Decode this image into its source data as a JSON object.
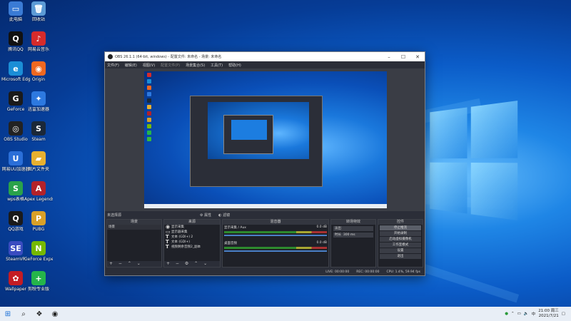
{
  "desktop": {
    "icons": [
      {
        "label": "此电脑",
        "glyph": "▭",
        "color": "#3a7bd5"
      },
      {
        "label": "回收站",
        "glyph": "🗑",
        "color": "#5c9bd6"
      },
      {
        "label": "腾讯QQ",
        "glyph": "Q",
        "color": "#111111"
      },
      {
        "label": "网易云音乐",
        "glyph": "♪",
        "color": "#d62b2b"
      },
      {
        "label": "Microsoft Edge",
        "glyph": "e",
        "color": "#1b8ed6"
      },
      {
        "label": "Origin",
        "glyph": "◉",
        "color": "#f06820"
      },
      {
        "label": "GeForce",
        "glyph": "G",
        "color": "#1a1a1a"
      },
      {
        "label": "迅雷加速器",
        "glyph": "✦",
        "color": "#2d79e0"
      },
      {
        "label": "OBS Studio",
        "glyph": "◎",
        "color": "#222222"
      },
      {
        "label": "Steam",
        "glyph": "S",
        "color": "#1b2838"
      },
      {
        "label": "网易UU加速器",
        "glyph": "U",
        "color": "#2b6fd8"
      },
      {
        "label": "图片文件夹",
        "glyph": "▰",
        "color": "#e8b030"
      },
      {
        "label": "wps表格",
        "glyph": "S",
        "color": "#2aa24a"
      },
      {
        "label": "Apex Legends",
        "glyph": "A",
        "color": "#b3222a"
      },
      {
        "label": "QQ游戏",
        "glyph": "Q",
        "color": "#1a1a1a"
      },
      {
        "label": "PUBG",
        "glyph": "P",
        "color": "#d8a028"
      },
      {
        "label": "SteamVR",
        "glyph": "SE",
        "color": "#3a4cc0"
      },
      {
        "label": "GeForce Experience",
        "glyph": "N",
        "color": "#76b900"
      },
      {
        "label": "Wallpaper",
        "glyph": "✿",
        "color": "#c41c24"
      },
      {
        "label": "剪映专业版",
        "glyph": "+",
        "color": "#25b54a"
      },
      {
        "label": "QQ影音",
        "glyph": "◑",
        "color": "#3ab83a"
      }
    ]
  },
  "obs": {
    "title": "OBS 26.1.1 (64-bit, windows) - 配置文件: 未命名 - 场景: 未命名",
    "menu": [
      "文件(F)",
      "编辑(E)",
      "视图(V)",
      "配置文件(P)",
      "场景集合(S)",
      "工具(T)",
      "帮助(H)"
    ],
    "no_source": "未选择源",
    "props_label": "属性",
    "filters_label": "滤镜",
    "docks": {
      "scenes": {
        "title": "场景",
        "items": [
          "场景"
        ]
      },
      "sources": {
        "title": "来源",
        "items": [
          "显示采集",
          "显示器采集",
          "文本 (GDI+) 2",
          "文本 (GDI+)",
          "视频剩余音频2_副本"
        ]
      },
      "mixer": {
        "title": "混音器",
        "channels": [
          {
            "name": "显示采集 / Aux",
            "db": "0.0 dB"
          },
          {
            "name": "桌面音频",
            "db": "0.0 dB"
          }
        ]
      },
      "transitions": {
        "title": "转场特效",
        "type": "淡出",
        "duration_label": "时长",
        "duration": "300 ms"
      },
      "controls": {
        "title": "控件",
        "buttons": [
          "停止推流",
          "开始录制",
          "启动虚拟摄像机",
          "工作室模式",
          "设置",
          "退出"
        ]
      }
    },
    "status": {
      "live": "LIVE: 00:00:00",
      "rec": "REC: 00:00:00",
      "cpu": "CPU: 1.4%, 59.94 fps"
    }
  },
  "taskbar": {
    "start_icon": "windows-icon",
    "time": "21:00 周三",
    "date": "2021/7/21"
  }
}
